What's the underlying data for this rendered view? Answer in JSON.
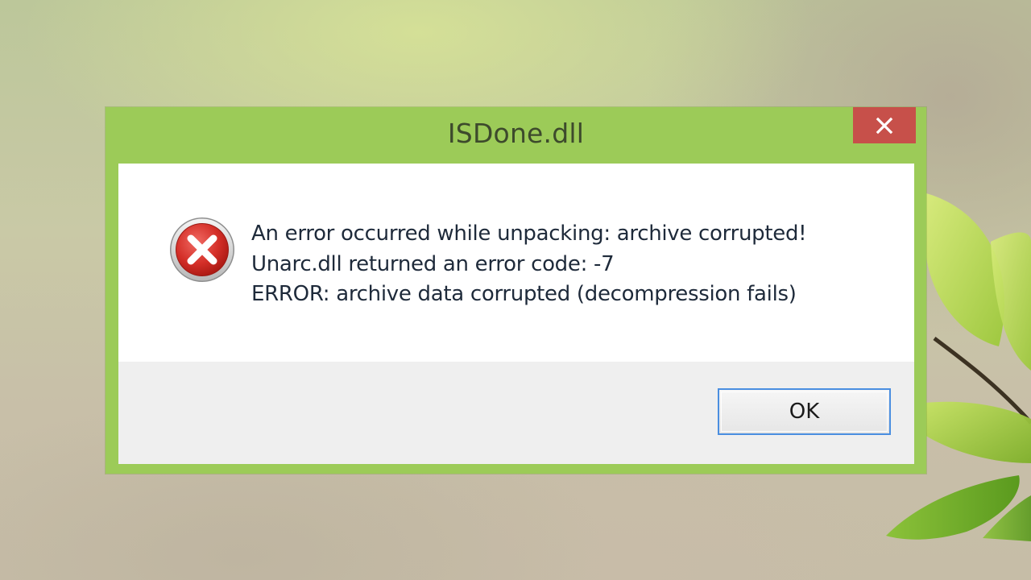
{
  "window": {
    "title": "ISDone.dll",
    "close_icon": "close-icon",
    "close_color": "#c7504a",
    "frame_color": "#9ccb58"
  },
  "message": {
    "icon": "error-icon",
    "lines": [
      "An error occurred while unpacking: archive corrupted!",
      "Unarc.dll returned an error code: -7",
      "ERROR: archive data corrupted (decompression fails)"
    ]
  },
  "buttons": {
    "ok_label": "OK",
    "ok_border_color": "#4a8ee0"
  }
}
